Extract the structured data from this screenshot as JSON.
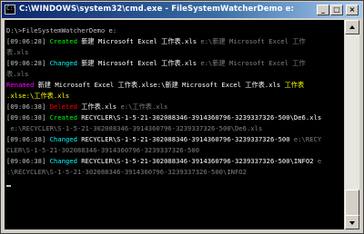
{
  "window": {
    "title": "C:\\WINDOWS\\system32\\cmd.exe - FileSystemWatcherDemo e:",
    "icon": "cmd-icon",
    "minimize": "_",
    "maximize": "□",
    "close": "×"
  },
  "console": {
    "prompt": "D:\\>FileSystemWatcherDemo e:",
    "lines": [
      {
        "ts": "[09:06:28]",
        "event": "Created",
        "name": "新建 Microsoft Excel 工作表.xls",
        "path": "e:\\新建 Microsoft Excel 工作表.xls"
      },
      {
        "ts": "[09:06:28]",
        "event": "Changed",
        "name": "新建 Microsoft Excel 工作表.xls",
        "path": "e:\\新建 Microsoft Excel 工作表.xls"
      },
      {
        "event": "Renamed",
        "name": "新建 Microsoft Excel 工作表.xlsx",
        "arrow": ":\\新建 Microsoft Excel 工作表.xls",
        "path": "工作表.xlsx",
        "path_prefix": ".xlse:\\"
      },
      {
        "ts": "[09:06:38]",
        "event": "Deleted",
        "name": "工作表.xls",
        "path": "e:\\工作表.xls"
      },
      {
        "ts": "[09:06:38]",
        "event": "Created",
        "name": "RECYCLER\\S-1-5-21-302088346-3914360796-3239337326-500\\De6.xls",
        "path": "e:\\RECYCLER\\S-1-5-21-302088346-3914360796-3239337326-500\\De6.xls"
      },
      {
        "ts": "[09:06:38]",
        "event": "Changed",
        "name": "RECYCLER\\S-1-5-21-302088346-3914360796-3239337326-500",
        "path": "e:\\RECYCLER\\S-1-5-21-302088346-3914360796-3239337326-500"
      },
      {
        "ts": "[09:06:38]",
        "event": "Changed",
        "name": "RECYCLER\\S-1-5-21-302088346-3914360796-3239337326-500\\INFO2",
        "path": "e:\\RECYCLER\\S-1-5-21-302088346-3914360796-3239337326-500\\INFO2"
      }
    ]
  },
  "text": {
    "l1": "D:\\>FileSystemWatcherDemo e:",
    "l2_ts": "[09:06:28] ",
    "l2_ev": "Created",
    "l2_name": " 新建 Microsoft Excel 工作表.xls ",
    "l2_path": "e:\\新建 Microsoft Excel 工作",
    "l3": "表.xls",
    "l4_ts": "[09:06:28] ",
    "l4_ev": "Changed",
    "l4_name": " 新建 Microsoft Excel 工作表.xls ",
    "l4_path": "e:\\新建 Microsoft Excel 工作",
    "l5": "表.xls",
    "l6_ev": "Renamed",
    "l6_name": " 新建 Microsoft Excel 工作表.xlse:\\新建 Microsoft Excel 工作表.xls ",
    "l6_new": "工作表",
    "l7": ".xlse:\\工作表.xls",
    "l8_ts": "[09:06:38] ",
    "l8_ev": "Deleted",
    "l8_name": " 工作表.xls ",
    "l8_path": "e:\\工作表.xls",
    "l9_ts": "[09:06:38] ",
    "l9_ev": "Created",
    "l9_name": " RECYCLER\\S-1-5-21-302088346-3914360796-3239337326-500\\De6.xls",
    "l10": " e:\\RECYCLER\\S-1-5-21-302088346-3914360796-3239337326-500\\De6.xls",
    "l11_ts": "[09:06:38] ",
    "l11_ev": "Changed",
    "l11_name": " RECYCLER\\S-1-5-21-302088346-3914360796-3239337326-500 ",
    "l11_path": "e:\\RECY",
    "l12": "CLER\\S-1-5-21-302088346-3914360796-3239337326-500",
    "l13_ts": "[09:06:38] ",
    "l13_ev": "Changed",
    "l13_name": " RECYCLER\\S-1-5-21-302088346-3914360796-3239337326-500\\INFO2 ",
    "l13_path": "e",
    "l14": ":\\RECYCLER\\S-1-5-21-302088346-3914360796-3239337326-500\\INFO2"
  },
  "colors": {
    "created": "#00ff00",
    "changed": "#00ffff",
    "renamed": "#ff00ff",
    "deleted": "#ff0000",
    "renamed_new": "#ffff00",
    "path": "#808080",
    "name": "#ffffff"
  }
}
